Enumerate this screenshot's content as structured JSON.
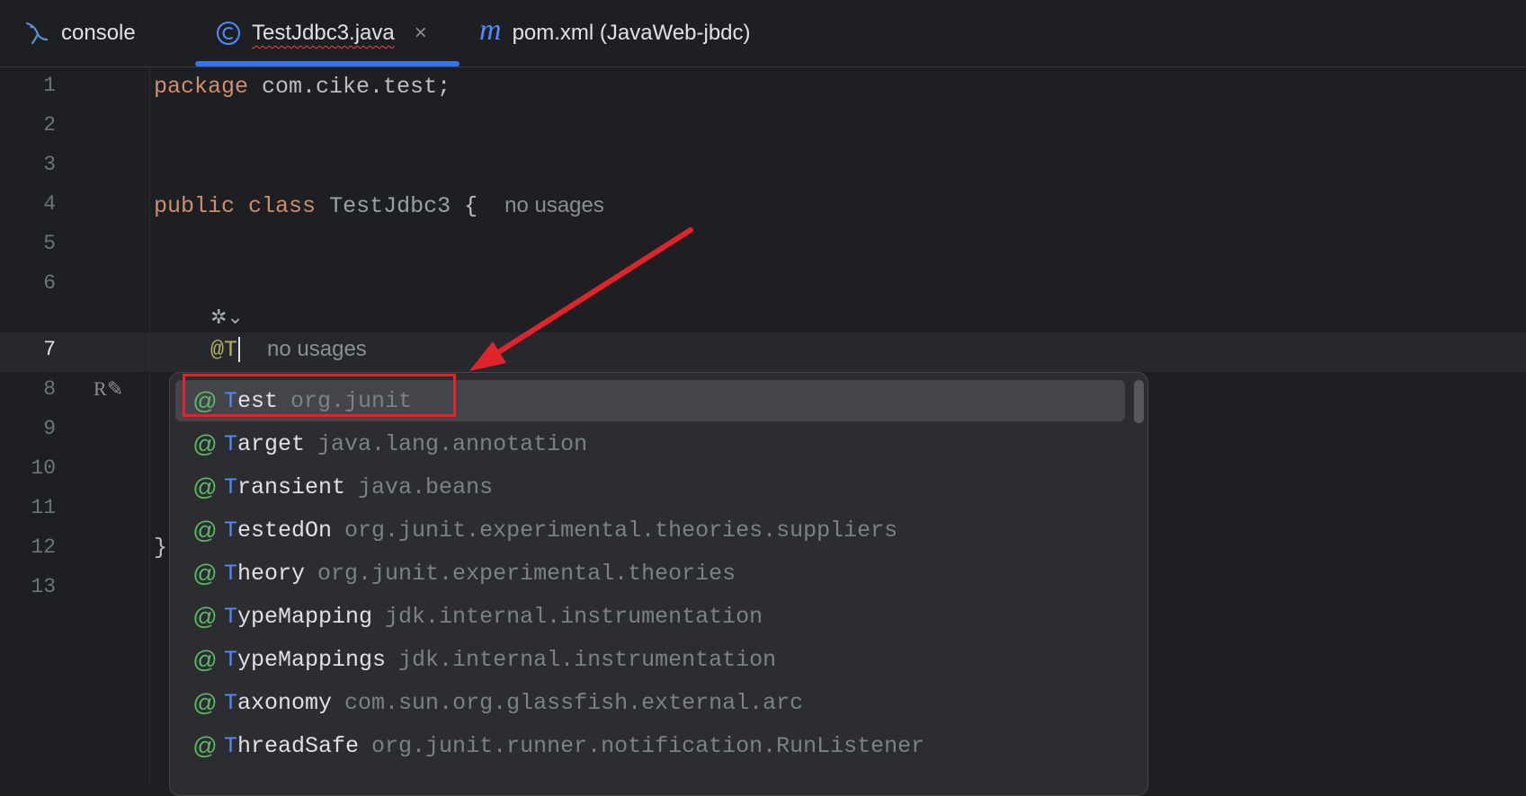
{
  "tabs": [
    {
      "label": "console"
    },
    {
      "label": "TestJdbc3.java",
      "close": "×"
    },
    {
      "label": "pom.xml (JavaWeb-jbdc)"
    }
  ],
  "editor": {
    "line_numbers": [
      "1",
      "2",
      "3",
      "4",
      "5",
      "6",
      "7",
      "8",
      "9",
      "10",
      "11",
      "12",
      "13"
    ],
    "lines": {
      "l1_kw": "package",
      "l1_rest": " com.cike.test;",
      "l4_kw1": "public",
      "l4_kw2": "class",
      "l4_cls": "TestJdbc3",
      "l4_brace": " {",
      "l4_hint": "no usages",
      "l7_ann": "@T",
      "l7_hint": "no usages",
      "l12": "}"
    },
    "gutter_r": "R"
  },
  "completion": {
    "items": [
      {
        "match": "T",
        "name": "est",
        "pkg": "org.junit"
      },
      {
        "match": "T",
        "name": "arget",
        "pkg": "java.lang.annotation"
      },
      {
        "match": "T",
        "name": "ransient",
        "pkg": "java.beans"
      },
      {
        "match": "T",
        "name": "estedOn",
        "pkg": "org.junit.experimental.theories.suppliers"
      },
      {
        "match": "T",
        "name": "heory",
        "pkg": "org.junit.experimental.theories"
      },
      {
        "match": "T",
        "name": "ypeMapping",
        "pkg": "jdk.internal.instrumentation"
      },
      {
        "match": "T",
        "name": "ypeMappings",
        "pkg": "jdk.internal.instrumentation"
      },
      {
        "match": "T",
        "name": "axonomy",
        "pkg": "com.sun.org.glassfish.external.arc"
      },
      {
        "match": "T",
        "name": "hreadSafe",
        "pkg": "org.junit.runner.notification.RunListener"
      }
    ]
  },
  "colors": {
    "accent": "#3574f0",
    "annotation_icon": "#5fb865",
    "highlight_box": "#e0242b"
  }
}
